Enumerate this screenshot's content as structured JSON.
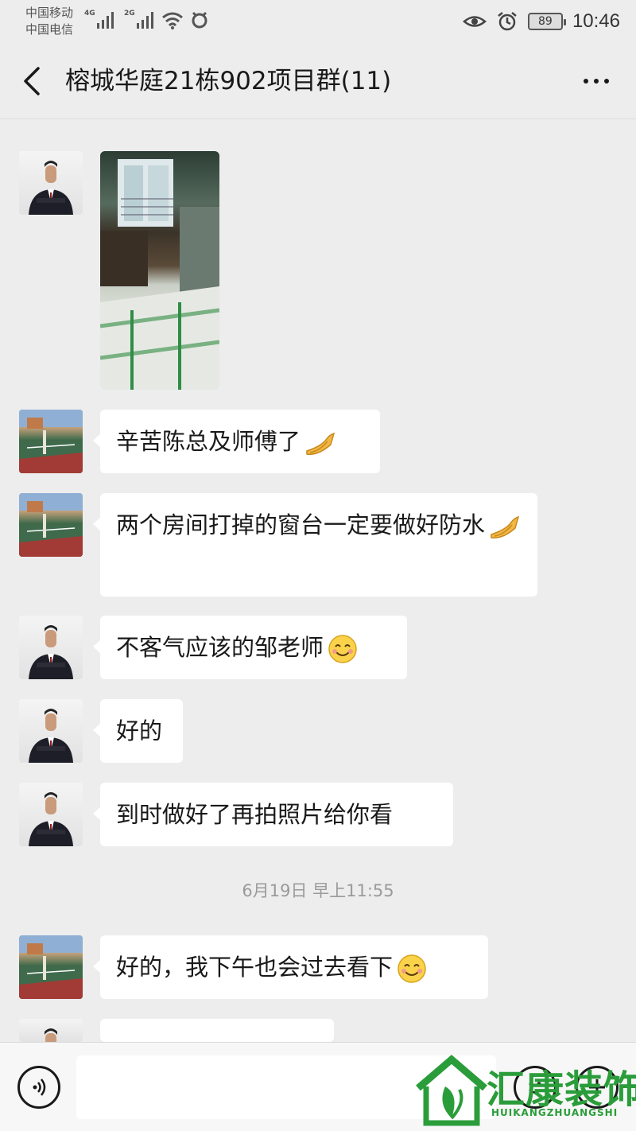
{
  "status_bar": {
    "carrier_1": "中国移动",
    "carrier_2": "中国电信",
    "signal_1_label": "4G",
    "signal_2_label": "2G",
    "battery": "89",
    "time": "10:46"
  },
  "chat": {
    "title": "榕城华庭21栋902项目群(11)"
  },
  "messages": [
    {
      "type": "image",
      "avatar": "man-in-suit",
      "content": "装修施工现场照片"
    },
    {
      "type": "text",
      "avatar": "sports-court",
      "text": "辛苦陈总及师傅了",
      "emoji": "pray-icon"
    },
    {
      "type": "text",
      "avatar": "sports-court",
      "text": "两个房间打掉的窗台一定要做好防水",
      "emoji": "pray-icon"
    },
    {
      "type": "text",
      "avatar": "man-in-suit",
      "text": "不客气应该的邹老师",
      "emoji": "smile-icon"
    },
    {
      "type": "text",
      "avatar": "man-in-suit",
      "text": "好的"
    },
    {
      "type": "text",
      "avatar": "man-in-suit",
      "text": "到时做好了再拍照片给你看"
    },
    {
      "type": "text",
      "avatar": "sports-court",
      "text": "好的，我下午也会过去看下",
      "emoji": "smile-icon"
    },
    {
      "type": "text",
      "avatar": "man-in-suit",
      "text": ""
    }
  ],
  "timestamp": "6月19日 早上11:55",
  "input": {
    "placeholder": "",
    "value": ""
  },
  "watermark": {
    "text": "汇康装饰",
    "subtitle": "HUIKANGZHUANGSHI",
    "color": "#2a9d3a"
  },
  "colors": {
    "background": "#ededed",
    "bubble": "#ffffff",
    "text": "#191919",
    "timestamp": "#9a9a9a"
  }
}
